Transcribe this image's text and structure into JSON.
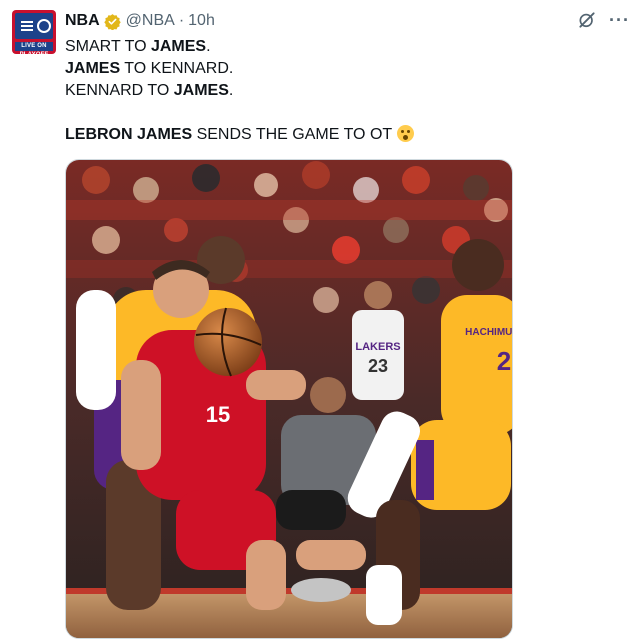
{
  "author": {
    "name": "NBA",
    "handle": "@NBA",
    "separator": "·",
    "time": "10h",
    "avatar_text": "LIVE ON PLAYOFF"
  },
  "tweet": {
    "line1": {
      "a": "SMART TO ",
      "b": "JAMES",
      "c": "."
    },
    "line2": {
      "a": "JAMES",
      "b": " TO KENNARD."
    },
    "line3": {
      "a": "KENNARD TO ",
      "b": "JAMES",
      "c": "."
    },
    "line5": {
      "a": "LEBRON JAMES",
      "b": " SENDS THE GAME TO OT"
    }
  },
  "media": {
    "jersey_red": "15",
    "jersey_yellow": "2",
    "jersey_yellow_name": "HACHIMURA",
    "fan_shirt": "LAKERS",
    "fan_number": "23"
  },
  "icons": {
    "verified": "verified-badge-icon",
    "grok": "grok-icon",
    "more": "more-icon",
    "emoji": "exploding-head-emoji"
  },
  "colors": {
    "rockets_red": "#ce1126",
    "lakers_gold": "#fdb927",
    "lakers_purple": "#552583",
    "verified": "#e2b719",
    "text_muted": "#536471"
  }
}
